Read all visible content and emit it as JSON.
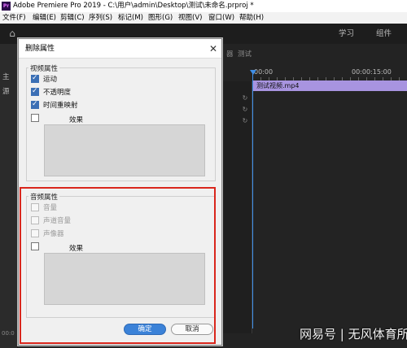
{
  "titlebar": {
    "app_icon": "Pr",
    "title": "Adobe Premiere Pro 2019 - C:\\用户\\admin\\Desktop\\测试\\未命名.prproj *"
  },
  "menu": [
    "文件(F)",
    "编辑(E)",
    "剪辑(C)",
    "序列(S)",
    "标记(M)",
    "图形(G)",
    "视图(V)",
    "窗口(W)",
    "帮助(H)"
  ],
  "workspace": {
    "tabs": [
      "学习",
      "组件"
    ]
  },
  "left_panel": {
    "labels": [
      "主",
      "源"
    ]
  },
  "timeline": {
    "tab_fragments": [
      "器",
      "测试"
    ],
    "time_start": "00:00",
    "time_mark": "00:00:15:00",
    "clip_label": "测试视频.mp4",
    "bottom_timecode": "00:0"
  },
  "dialog": {
    "title": "删除属性",
    "close_glyph": "✕",
    "video_group": {
      "label": "视频属性",
      "items": [
        {
          "label": "运动",
          "checked": true
        },
        {
          "label": "不透明度",
          "checked": true
        },
        {
          "label": "时间重映射",
          "checked": true
        }
      ],
      "effects_label": "效果"
    },
    "audio_group": {
      "label": "音频属性",
      "items": [
        {
          "label": "音量",
          "checked": false,
          "disabled": true
        },
        {
          "label": "声道音量",
          "checked": false,
          "disabled": true
        },
        {
          "label": "声像器",
          "checked": false,
          "disabled": true
        }
      ],
      "effects_label": "效果"
    },
    "ok_label": "确定",
    "cancel_label": "取消"
  },
  "watermark": "网易号 | 无风体育所",
  "colors": {
    "accent": "#3b82d8",
    "clip": "#a894e0",
    "playhead": "#3f8fe8",
    "highlight": "#d9261c"
  }
}
